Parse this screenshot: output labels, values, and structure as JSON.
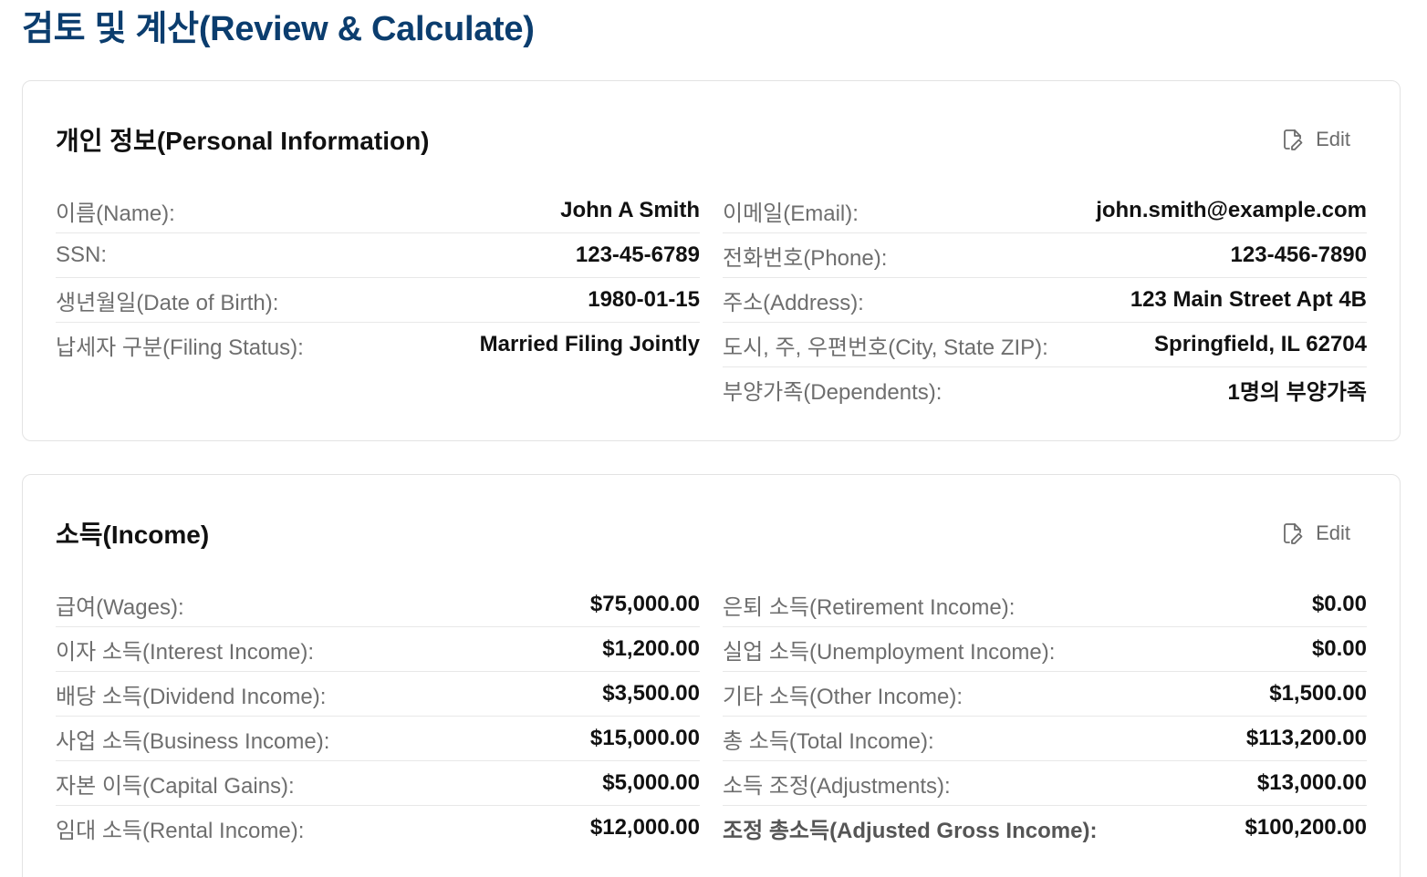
{
  "page": {
    "title": "검토 및 계산(Review & Calculate)"
  },
  "personal": {
    "title": "개인 정보(Personal Information)",
    "edit_label": "Edit",
    "left": [
      {
        "label": "이름(Name):",
        "value": "John A Smith"
      },
      {
        "label": "SSN:",
        "value": "123-45-6789"
      },
      {
        "label": "생년월일(Date of Birth):",
        "value": "1980-01-15"
      },
      {
        "label": "납세자 구분(Filing Status):",
        "value": "Married Filing Jointly"
      }
    ],
    "right": [
      {
        "label": "이메일(Email):",
        "value": "john.smith@example.com"
      },
      {
        "label": "전화번호(Phone):",
        "value": "123-456-7890"
      },
      {
        "label": "주소(Address):",
        "value": "123 Main Street Apt 4B"
      },
      {
        "label": "도시, 주, 우편번호(City, State ZIP):",
        "value": "Springfield, IL 62704"
      },
      {
        "label": "부양가족(Dependents):",
        "value": "1명의 부양가족"
      }
    ]
  },
  "income": {
    "title": "소득(Income)",
    "edit_label": "Edit",
    "left": [
      {
        "label": "급여(Wages):",
        "value": "$75,000.00"
      },
      {
        "label": "이자 소득(Interest Income):",
        "value": "$1,200.00"
      },
      {
        "label": "배당 소득(Dividend Income):",
        "value": "$3,500.00"
      },
      {
        "label": "사업 소득(Business Income):",
        "value": "$15,000.00"
      },
      {
        "label": "자본 이득(Capital Gains):",
        "value": "$5,000.00"
      },
      {
        "label": "임대 소득(Rental Income):",
        "value": "$12,000.00"
      }
    ],
    "right": [
      {
        "label": "은퇴 소득(Retirement Income):",
        "value": "$0.00"
      },
      {
        "label": "실업 소득(Unemployment Income):",
        "value": "$0.00"
      },
      {
        "label": "기타 소득(Other Income):",
        "value": "$1,500.00"
      },
      {
        "label": "총 소득(Total Income):",
        "value": "$113,200.00"
      },
      {
        "label": "소득 조정(Adjustments):",
        "value": "$13,000.00"
      },
      {
        "label": "조정 총소득(Adjusted Gross Income):",
        "value": "$100,200.00"
      }
    ]
  },
  "colors": {
    "title": "#0b3d6e",
    "label": "#6e6e6e",
    "value": "#111111",
    "border": "#e3e3e3"
  },
  "icons": {
    "edit": "file-edit-icon"
  }
}
